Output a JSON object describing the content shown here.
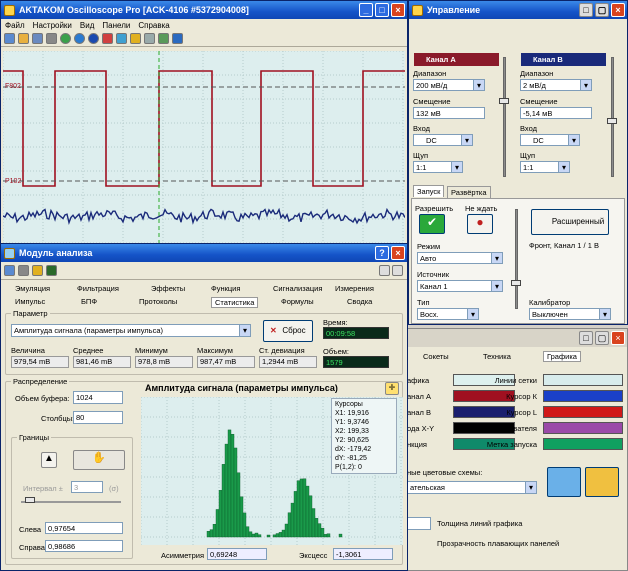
{
  "scope": {
    "title": "AKTAKOM Oscilloscope Pro [ACK-4106 #5372904008]",
    "menu": [
      "Файл",
      "Настройки",
      "Вид",
      "Панели",
      "Справка"
    ],
    "marker_top": "F802",
    "marker_bottom": "P102",
    "colors": {
      "bg": "#ddeeee",
      "grid": "#b5cccc",
      "trace_a": "#a01020",
      "trace_b": "#1a2a7a",
      "cursor": "#2aaa2a"
    }
  },
  "control": {
    "title": "Управление",
    "chA": {
      "name": "Канал А",
      "range_label": "Диапазон",
      "range": "200 мВ/д",
      "offset_label": "Смещение",
      "offset": "132 мВ",
      "input_label": "Вход",
      "input": "DC",
      "probe_label": "Щуп",
      "probe": "1:1"
    },
    "chB": {
      "name": "Канал В",
      "range_label": "Диапазон",
      "range": "2 мВ/д",
      "offset_label": "Смещение",
      "offset": "-5,14 мВ",
      "input_label": "Вход",
      "input": "DC",
      "probe_label": "Щуп",
      "probe": "1:1"
    },
    "tabs": [
      "Запуск",
      "Развёртка"
    ],
    "enable": "Разрешить",
    "nowait": "Не ждать",
    "advanced": "Расширенный",
    "mode_label": "Режим",
    "mode": "Авто",
    "source_label": "Источник",
    "source": "Канал 1",
    "type_label": "Тип",
    "type": "Восх.",
    "front": "Фронт, Канал 1 / 1 В",
    "calib_label": "Калибратор",
    "calib": "Выключен"
  },
  "analysis": {
    "title": "Модуль анализа",
    "tabs1": [
      "Эмуляция",
      "Фильтрация",
      "Эффекты",
      "Функция",
      "Сигнализация",
      "Измерения"
    ],
    "tabs2": [
      "Импульс",
      "БПФ",
      "Протоколы",
      "Статистика",
      "Формулы",
      "Сводка"
    ],
    "param_group": "Параметр",
    "param": "Амплитуда сигнала (параметры импульса)",
    "reset": "Сброс",
    "time_label": "Время:",
    "time": "00:09:58",
    "volume_label": "Объем:",
    "volume": "1579",
    "stats": [
      {
        "label": "Величина",
        "value": "979,54 mB"
      },
      {
        "label": "Среднее",
        "value": "981,46 mB"
      },
      {
        "label": "Минимум",
        "value": "978,8 mB"
      },
      {
        "label": "Максимум",
        "value": "987,47 mB"
      },
      {
        "label": "Ст. девиация",
        "value": "1,2944 mB"
      }
    ],
    "dist_group": "Распределение",
    "buffer_label": "Объем буфера:",
    "buffer": "1024",
    "columns_label": "Столбцы:",
    "columns": "80",
    "bounds_group": "Границы",
    "interval_label": "Интервал ±",
    "interval": "3",
    "sigma": "(σ)",
    "left_label": "Слева",
    "left": "0,97654",
    "right_label": "Справа",
    "right": "0,98686",
    "chart_title": "Амплитуда сигнала (параметры импульса)",
    "cursors": [
      "Курсоры",
      "X1: 19,916",
      "Y1: 9,3746",
      "X2: 199,33",
      "Y2: 90,625",
      "dX: -179,42",
      "dY: -81,25",
      "P(1,2): 0"
    ],
    "asym_label": "Асимметрия",
    "asym": "0,69248",
    "excess_label": "Эксцесс",
    "excess": "-1,3061"
  },
  "settings": {
    "tabs": [
      "Сокеты",
      "Техника",
      "Графика"
    ],
    "left": [
      {
        "label": "афика",
        "color": "#ddf0ee"
      },
      {
        "label": "анал А",
        "color": "#a01020"
      },
      {
        "label": "анал В",
        "color": "#1a1f6e"
      },
      {
        "label": "ода X-Y",
        "color": "#000000"
      },
      {
        "label": "нкция",
        "color": "#0f8a6a"
      }
    ],
    "right": [
      {
        "label": "Линии сетки",
        "color": "#d8ecec"
      },
      {
        "label": "Курсор К",
        "color": "#1a40c8"
      },
      {
        "label": "Курсор L",
        "color": "#d01818"
      },
      {
        "label": "Метки пользователя",
        "color": "#9a4aa8"
      },
      {
        "label": "Метка запуска",
        "color": "#10a060"
      }
    ],
    "schemes_label": "ные цветовые схемы:",
    "scheme": "ательская",
    "line_width": "Толщина линий графика",
    "transparency": "Прозрачность плавающих панелей"
  }
}
